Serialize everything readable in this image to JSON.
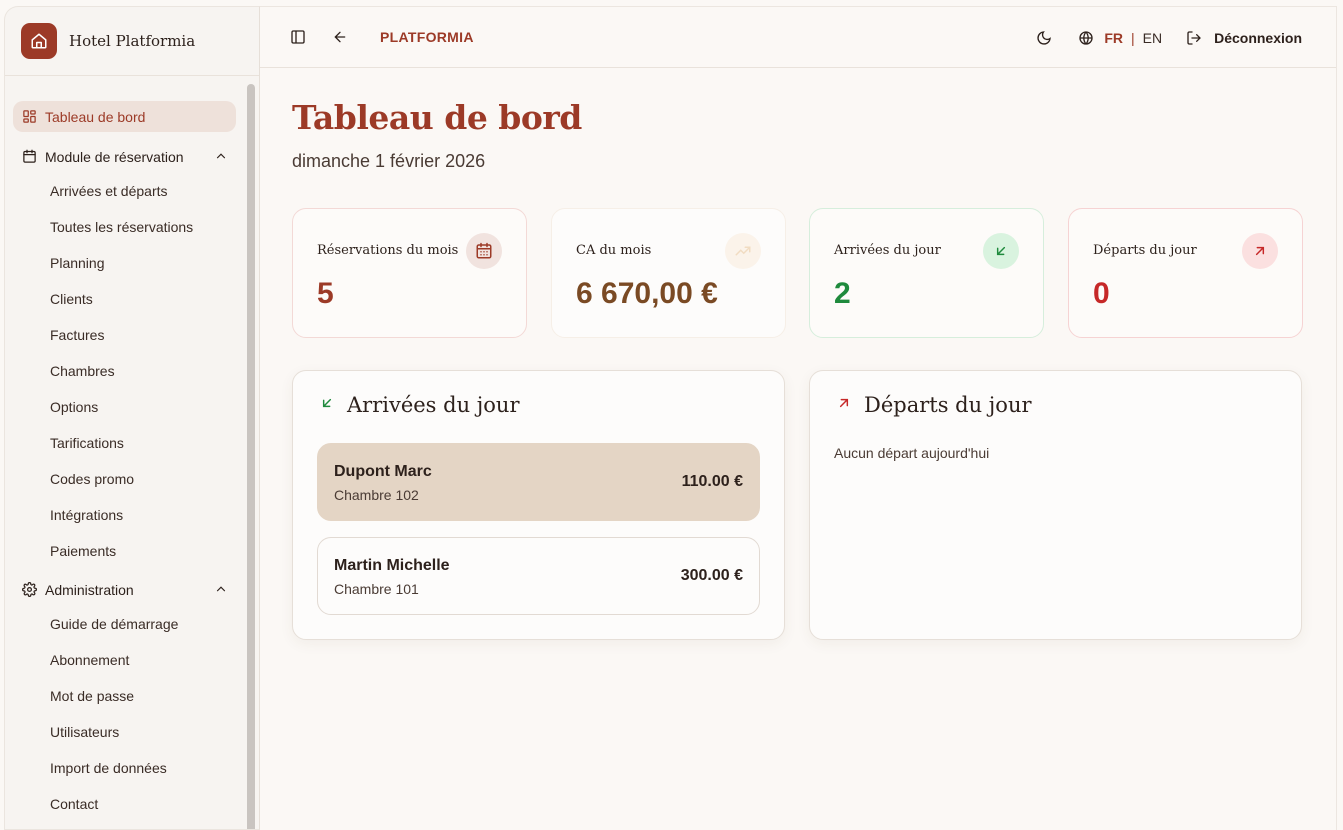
{
  "brand": {
    "name": "Hotel Platformia",
    "icon": "home-icon"
  },
  "sidebar": {
    "dashboard": {
      "label": "Tableau de bord",
      "icon": "dashboard-grid-icon"
    },
    "reservation": {
      "label": "Module de réservation",
      "icon": "calendar-icon",
      "items": [
        "Arrivées et départs",
        "Toutes les réservations",
        "Planning",
        "Clients",
        "Factures",
        "Chambres",
        "Options",
        "Tarifications",
        "Codes promo",
        "Intégrations",
        "Paiements"
      ]
    },
    "admin": {
      "label": "Administration",
      "icon": "gear-icon",
      "items": [
        "Guide de démarrage",
        "Abonnement",
        "Mot de passe",
        "Utilisateurs",
        "Import de données",
        "Contact"
      ]
    }
  },
  "topbar": {
    "breadcrumb": "PLATFORMIA",
    "lang_fr": "FR",
    "lang_sep": "|",
    "lang_en": "EN",
    "logout": "Déconnexion"
  },
  "page": {
    "title": "Tableau de bord",
    "date": "dimanche 1 février 2026"
  },
  "stats": {
    "reservations": {
      "label": "Réservations du mois",
      "value": "5",
      "color": "#9c3a27"
    },
    "revenue": {
      "label": "CA du mois",
      "value": "6 670,00 €",
      "color": "#7a4a24"
    },
    "arrivals": {
      "label": "Arrivées du jour",
      "value": "2",
      "color": "#1f8a3d"
    },
    "departures": {
      "label": "Départs du jour",
      "value": "0",
      "color": "#c62828"
    }
  },
  "arrivals_panel": {
    "title": "Arrivées du jour",
    "rows": [
      {
        "name": "Dupont Marc",
        "room": "Chambre 102",
        "amount": "110.00 €"
      },
      {
        "name": "Martin Michelle",
        "room": "Chambre 101",
        "amount": "300.00 €"
      }
    ]
  },
  "departures_panel": {
    "title": "Départs du jour",
    "empty": "Aucun départ aujourd'hui"
  },
  "colors": {
    "accent": "#9c3a27",
    "green": "#1f8a3d",
    "red": "#c62828"
  }
}
